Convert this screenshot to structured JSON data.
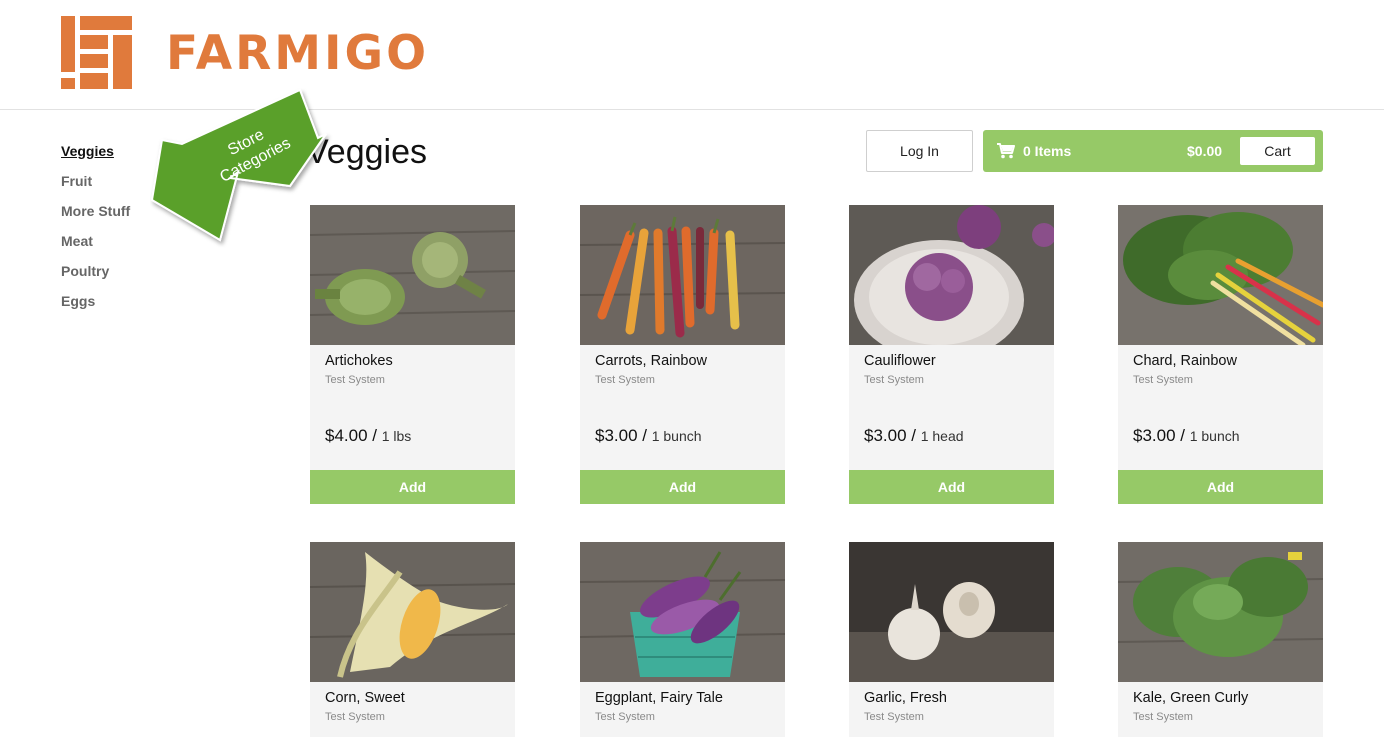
{
  "brand": {
    "name": "FARMIGO",
    "color": "#e07a3c"
  },
  "colors": {
    "accent_green": "#96c967",
    "callout_green": "#5aa02c"
  },
  "sidebar": {
    "items": [
      {
        "label": "Veggies",
        "active": true
      },
      {
        "label": "Fruit"
      },
      {
        "label": "More Stuff"
      },
      {
        "label": "Meat"
      },
      {
        "label": "Poultry"
      },
      {
        "label": "Eggs"
      }
    ]
  },
  "callout": {
    "line1": "Store",
    "line2": "Categories"
  },
  "page": {
    "title": "Veggies"
  },
  "header": {
    "login_label": "Log In"
  },
  "cart": {
    "icon": "cart-icon",
    "items_label": "0 Items",
    "total": "$0.00",
    "button_label": "Cart"
  },
  "products": [
    {
      "name": "Artichokes",
      "vendor": "Test System",
      "price": "$4.00",
      "sep": " / ",
      "unit": "1 lbs",
      "add_label": "Add",
      "image": "artichoke"
    },
    {
      "name": "Carrots, Rainbow",
      "vendor": "Test System",
      "price": "$3.00",
      "sep": " / ",
      "unit": "1 bunch",
      "add_label": "Add",
      "image": "carrots"
    },
    {
      "name": "Cauliflower",
      "vendor": "Test System",
      "price": "$3.00",
      "sep": " / ",
      "unit": "1 head",
      "add_label": "Add",
      "image": "cauliflower"
    },
    {
      "name": "Chard, Rainbow",
      "vendor": "Test System",
      "price": "$3.00",
      "sep": " / ",
      "unit": "1 bunch",
      "add_label": "Add",
      "image": "chard"
    },
    {
      "name": "Corn, Sweet",
      "vendor": "Test System",
      "image": "corn"
    },
    {
      "name": "Eggplant, Fairy Tale",
      "vendor": "Test System",
      "image": "eggplant"
    },
    {
      "name": "Garlic, Fresh",
      "vendor": "Test System",
      "image": "garlic"
    },
    {
      "name": "Kale, Green Curly",
      "vendor": "Test System",
      "image": "kale"
    }
  ]
}
